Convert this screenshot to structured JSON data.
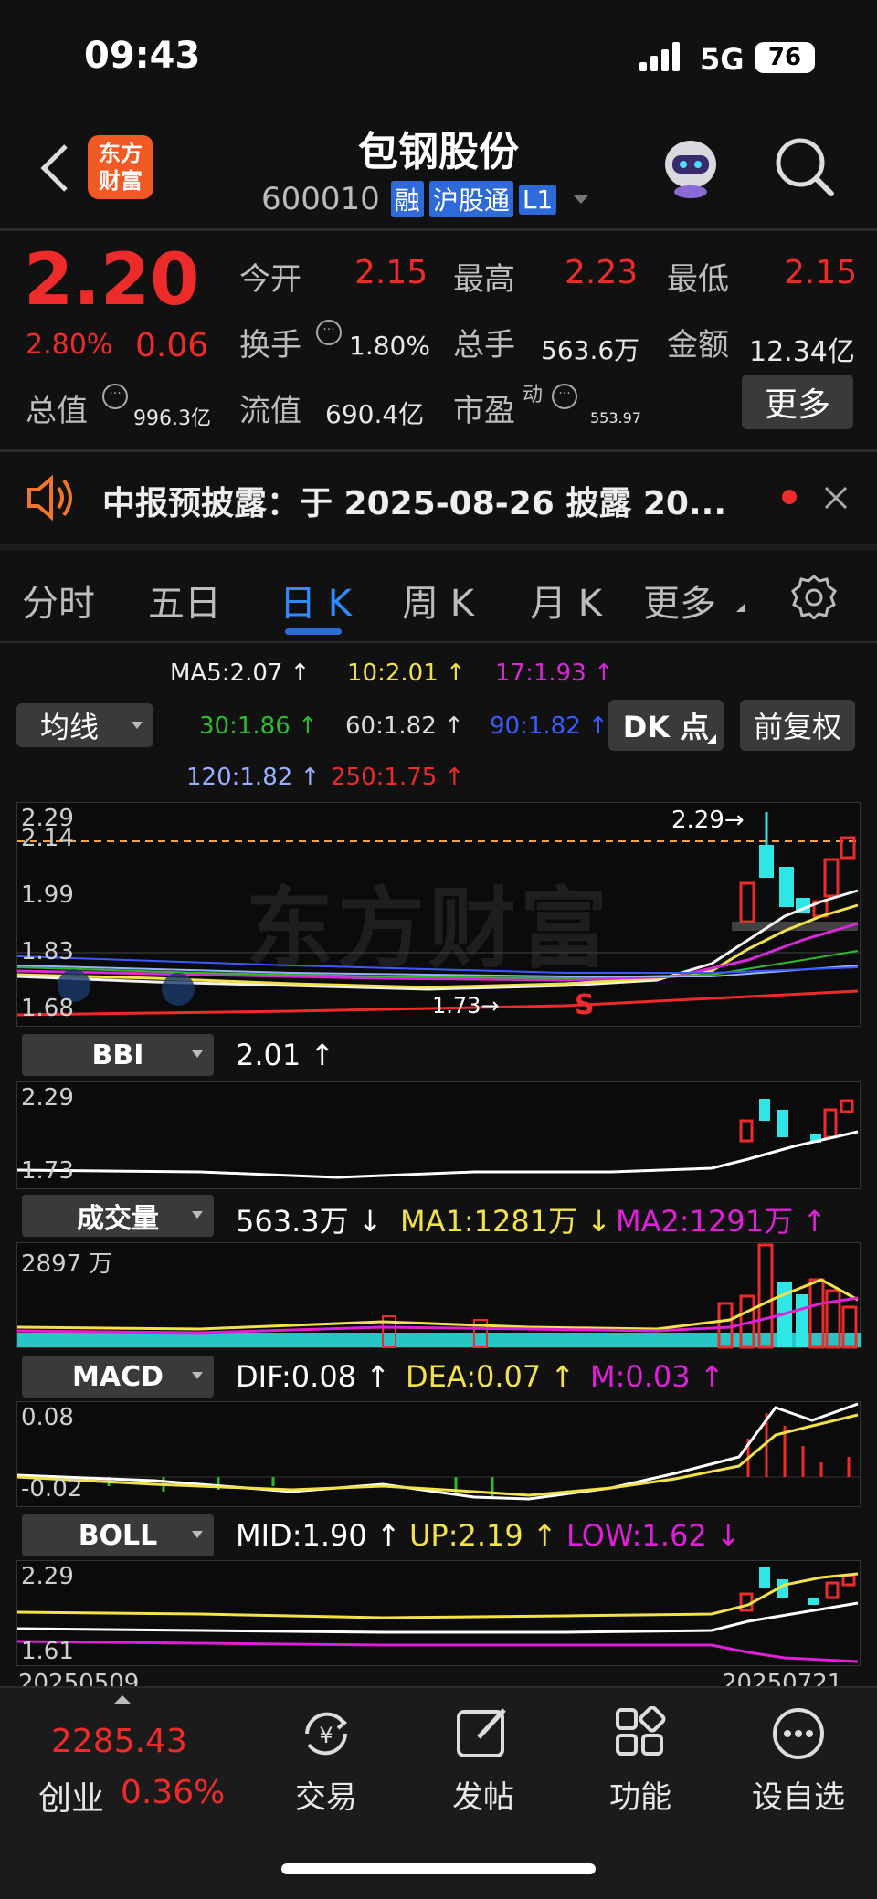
{
  "status_bar": {
    "time": "09:43",
    "network": "5G",
    "battery": "76"
  },
  "header": {
    "logo_line1": "东方",
    "logo_line2": "财富",
    "stock_name": "包钢股份",
    "stock_code": "600010",
    "tags": [
      "融",
      "沪股通",
      "L1"
    ]
  },
  "quote": {
    "price": "2.20",
    "change_pct": "2.80%",
    "change": "0.06",
    "open_label": "今开",
    "open": "2.15",
    "high_label": "最高",
    "high": "2.23",
    "low_label": "最低",
    "low": "2.15",
    "turnover_label": "换手",
    "turnover": "1.80%",
    "volume_label": "总手",
    "volume": "563.6万",
    "amount_label": "金额",
    "amount": "12.34亿",
    "market_cap_label": "总值",
    "market_cap": "996.3亿",
    "float_cap_label": "流值",
    "float_cap": "690.4亿",
    "pe_label": "市盈",
    "pe_sup": "动",
    "pe": "553.97",
    "more_button": "更多"
  },
  "notice": {
    "text": "中报预披露：于 2025-08-26 披露 20..."
  },
  "tabs": {
    "items": [
      "分时",
      "五日",
      "日 K",
      "周 K",
      "月 K",
      "更多"
    ],
    "active": 2
  },
  "ma_legend": {
    "ma5": "MA5:2.07 ↑",
    "ma10": "10:2.01 ↑",
    "ma17": "17:1.93 ↑",
    "ma30": "30:1.86 ↑",
    "ma60": "60:1.82 ↑",
    "ma90": "90:1.82 ↑",
    "ma120": "120:1.82 ↑",
    "ma250": "250:1.75 ↑",
    "selector": "均线",
    "dk_button": "DK 点",
    "adjust_button": "前复权"
  },
  "main_chart": {
    "y_labels": [
      "2.29",
      "2.14",
      "1.99",
      "1.83",
      "1.68"
    ],
    "high_marker": "2.29→",
    "low_marker": "1.73→",
    "sell_marker": "S",
    "watermark": "东方财富"
  },
  "bbi": {
    "selector": "BBI",
    "value": "2.01 ↑",
    "y_labels": [
      "2.29",
      "1.73"
    ]
  },
  "volume_ind": {
    "selector": "成交量",
    "value": "563.3万 ↓",
    "ma1": "MA1:1281万 ↓",
    "ma2": "MA2:1291万 ↑",
    "y_label": "2897 万"
  },
  "macd": {
    "selector": "MACD",
    "dif": "DIF:0.08 ↑",
    "dea": "DEA:0.07 ↑",
    "m": "M:0.03 ↑",
    "y_labels": [
      "0.08",
      "-0.02"
    ]
  },
  "boll": {
    "selector": "BOLL",
    "mid": "MID:1.90 ↑",
    "up": "UP:2.19 ↑",
    "low": "LOW:1.62 ↓",
    "y_labels": [
      "2.29",
      "1.61"
    ]
  },
  "dates": {
    "start": "20250509",
    "end": "20250721"
  },
  "bottom_nav": {
    "index_value": "2285.43",
    "index_name": "创业",
    "index_change": "0.36%",
    "items": [
      "交易",
      "发帖",
      "功能",
      "设自选"
    ]
  },
  "colors": {
    "up": "#ee2b2b",
    "down": "#2ee6e6",
    "accent": "#2f6bd8",
    "yellow": "#f2e24a",
    "magenta": "#e020d8"
  }
}
